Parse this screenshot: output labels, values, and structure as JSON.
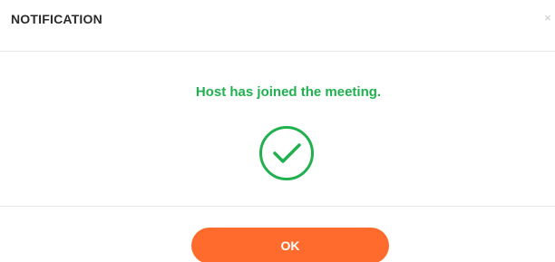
{
  "dialog": {
    "title": "NOTIFICATION",
    "close_glyph": "×",
    "message": "Host has joined the meeting.",
    "status_icon": "check-circle-icon",
    "ok_label": "OK"
  },
  "colors": {
    "success": "#21b04f",
    "accent": "#ff6b2c",
    "title_text": "#2b2b2b",
    "divider": "#e6e6e6"
  }
}
